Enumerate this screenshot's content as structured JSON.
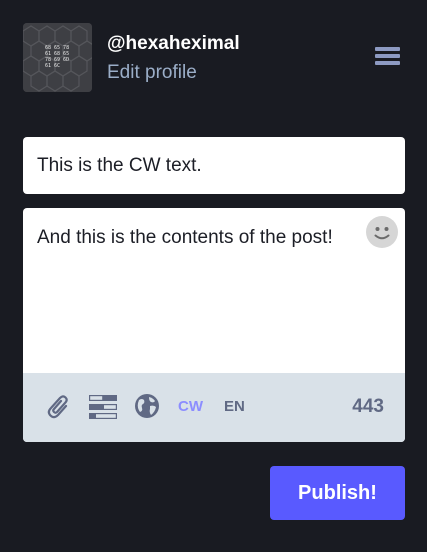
{
  "account": {
    "handle": "@hexaheximal",
    "edit_profile_label": "Edit profile",
    "avatar_text_lines": [
      "68 65 78",
      "61 68 65",
      "78 69 6D",
      "61 6C"
    ]
  },
  "compose": {
    "cw_text": "This is the CW text.",
    "post_text": "And this is the contents of the post!",
    "cw_toggle_label": "CW",
    "language_label": "EN",
    "char_count": "443"
  },
  "publish": {
    "label": "Publish!"
  },
  "icons": {
    "menu": "hamburger-menu-icon",
    "emoji": "smiley-face-icon",
    "attach": "paperclip-icon",
    "poll": "poll-bars-icon",
    "visibility": "globe-icon"
  },
  "colors": {
    "background": "#191b22",
    "accent": "#595aff",
    "cw_active": "#8c8dff",
    "muted": "#606984",
    "link": "#9baec8",
    "toolbar": "#d9e1e8"
  }
}
